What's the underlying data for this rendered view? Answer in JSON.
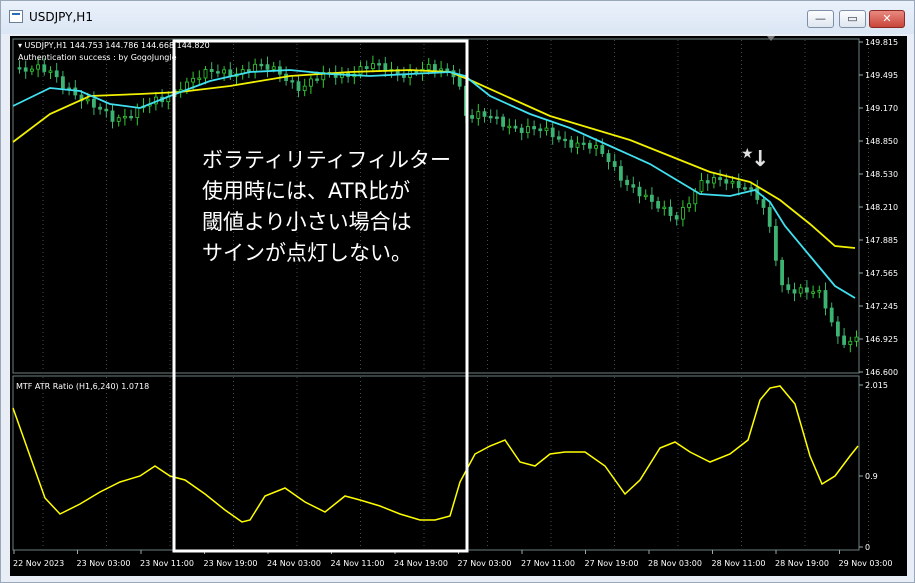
{
  "window": {
    "title": "USDJPY,H1",
    "minimize_symbol": "—",
    "maximize_symbol": "▭",
    "close_symbol": "✕"
  },
  "price_panel": {
    "symbol_line": "▾ USDJPY,H1  144.753 144.786 144.668 144.820",
    "auth_line": "Authentication success : by GogoJungle",
    "y_ticks": [
      "149.815",
      "149.495",
      "149.170",
      "148.850",
      "148.530",
      "148.210",
      "147.885",
      "147.565",
      "147.245",
      "146.925",
      "146.600"
    ],
    "signal_star": "★",
    "signal_arrow": "↓"
  },
  "indicator_panel": {
    "label": "MTF ATR Ratio  (H1,6,240) 1.0718",
    "y_ticks": [
      "2.015",
      "0.9",
      "0"
    ]
  },
  "x_ticks": [
    "22 Nov 2023",
    "23 Nov 03:00",
    "23 Nov 11:00",
    "23 Nov 19:00",
    "24 Nov 03:00",
    "24 Nov 11:00",
    "24 Nov 19:00",
    "27 Nov 03:00",
    "27 Nov 11:00",
    "27 Nov 19:00",
    "28 Nov 03:00",
    "28 Nov 11:00",
    "28 Nov 19:00",
    "29 Nov 03:00"
  ],
  "annotation": {
    "lines": [
      "ボラティリティフィルター",
      "使用時には、ATR比が",
      "閾値より小さい場合は",
      "サインが点灯しない。"
    ]
  },
  "colors": {
    "background": "#000000",
    "grid": "#6b8080",
    "bull_candle": "#32cd32",
    "bear_candle": "#3cb371",
    "fast_ma": "#40e0f0",
    "slow_ma": "#f0f000",
    "atr_line": "#ffff00",
    "annotation_box": "#ffffff"
  }
}
